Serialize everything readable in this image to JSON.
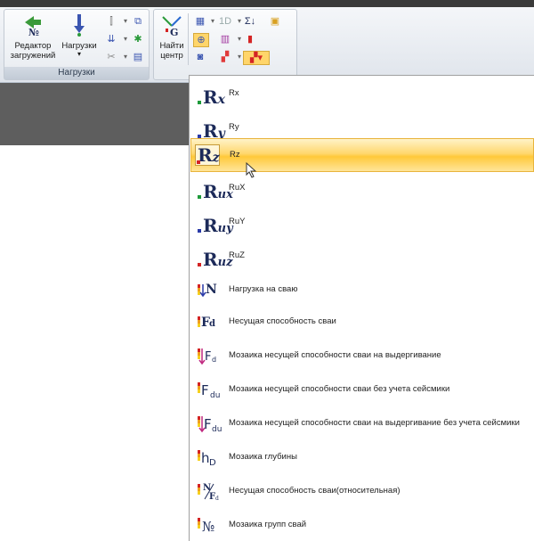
{
  "ribbon": {
    "editor_label": "Редактор загружений",
    "loads_label": "Нагрузки",
    "group1_caption": "Нагрузки",
    "find_center_label": "Найти центр"
  },
  "menu": {
    "items": [
      {
        "label": "Rx",
        "icon": "rx-icon"
      },
      {
        "label": "Ry",
        "icon": "ry-icon"
      },
      {
        "label": "Rz",
        "icon": "rz-icon"
      },
      {
        "label": "RuX",
        "icon": "rux-icon"
      },
      {
        "label": "RuY",
        "icon": "ruy-icon"
      },
      {
        "label": "RuZ",
        "icon": "ruz-icon"
      },
      {
        "label": "Нагрузка на сваю",
        "icon": "pile-load-icon"
      },
      {
        "label": "Несущая способность сваи",
        "icon": "pile-capacity-icon"
      },
      {
        "label": "Мозаика несущей способности сваи на выдергивание",
        "icon": "pullout-mosaic-icon"
      },
      {
        "label": "Мозаика несущей способности сваи без учета сейсмики",
        "icon": "capacity-noseismic-icon"
      },
      {
        "label": "Мозаика несущей способности сваи на выдергивание без учета сейсмики",
        "icon": "pullout-noseismic-icon"
      },
      {
        "label": "Мозаика глубины",
        "icon": "depth-mosaic-icon"
      },
      {
        "label": "Несущая способность сваи(относительная)",
        "icon": "relative-capacity-icon"
      },
      {
        "label": "Мозаика групп свай",
        "icon": "pile-groups-icon"
      }
    ],
    "selected_index": 2
  },
  "colors": {
    "highlight": "#ffd76e",
    "icon_text": "#1c2a59",
    "marker_green": "#1e9a3a",
    "marker_red": "#d42424",
    "marker_blue": "#2a3aa8"
  }
}
